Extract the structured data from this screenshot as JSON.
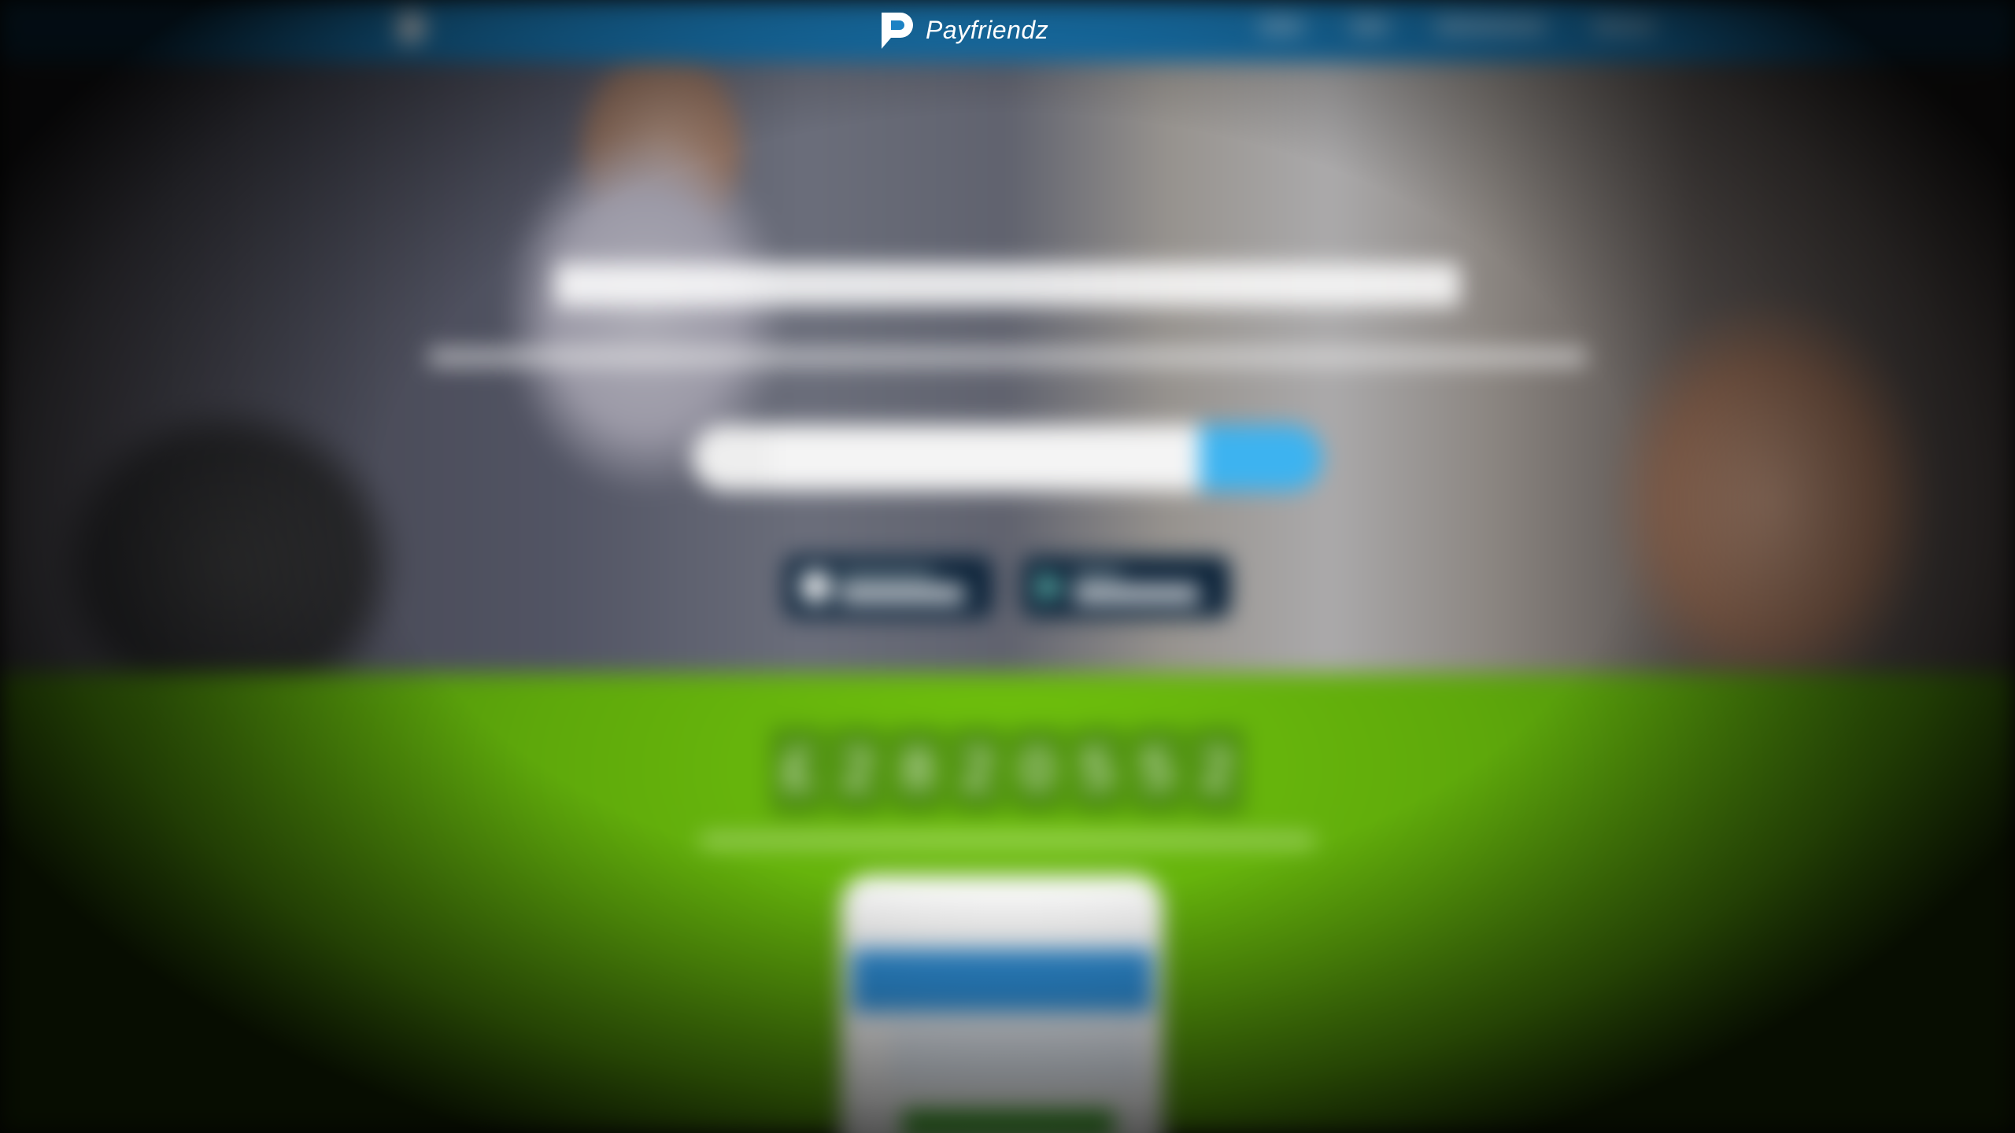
{
  "brand": {
    "name": "Payfriendz",
    "logo_icon": "p-speech-bubble-icon",
    "nav_color": "#1c82c4"
  },
  "counter": {
    "digits": [
      "£",
      "2",
      "8",
      "2",
      "0",
      "5",
      "5",
      "2"
    ]
  }
}
